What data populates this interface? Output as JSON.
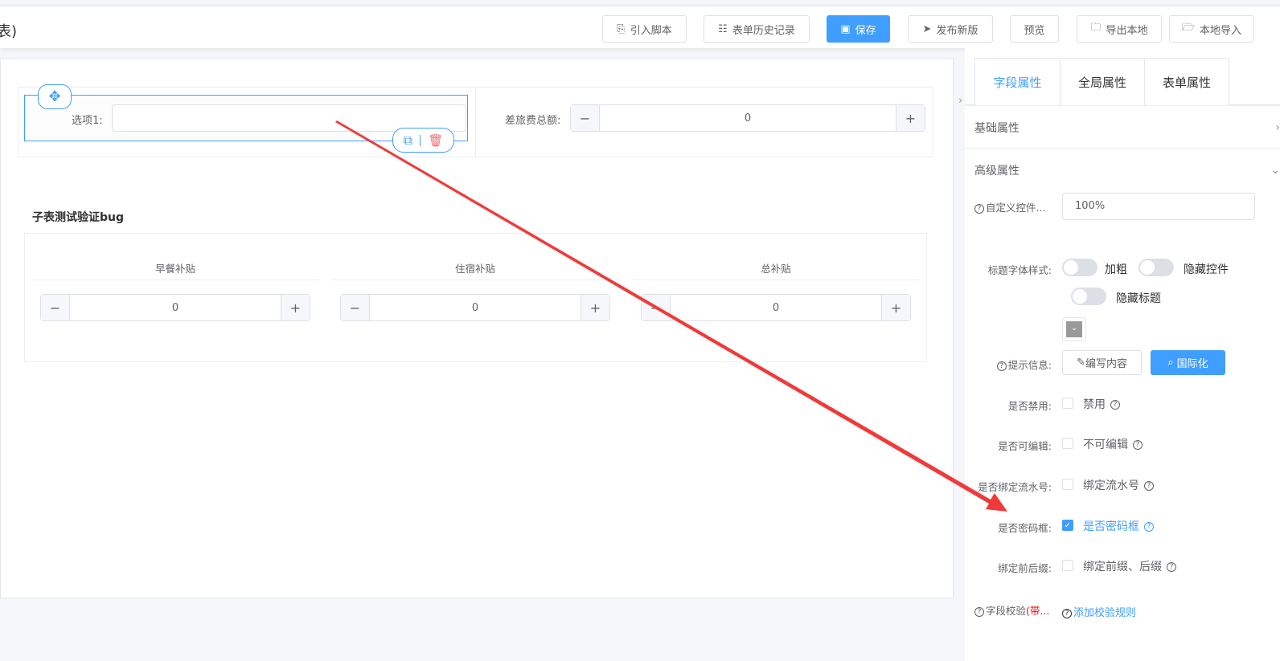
{
  "header": {
    "title": "表)",
    "buttons": [
      {
        "label": "引入脚本",
        "icon": "script-icon"
      },
      {
        "label": "表单历史记录",
        "icon": "list-icon"
      },
      {
        "label": "保存",
        "icon": "save-icon"
      },
      {
        "label": "发布新版",
        "icon": "send-icon"
      },
      {
        "label": "预览"
      },
      {
        "label": "导出本地",
        "icon": "folder-icon"
      },
      {
        "label": "本地导入",
        "icon": "folder-open-icon"
      }
    ]
  },
  "form": {
    "field1": {
      "label": "选项1:",
      "value": ""
    },
    "field2": {
      "label": "差旅费总额:",
      "value": "0",
      "minus": "−",
      "plus": "+"
    },
    "subtable": {
      "title": "子表测试验证bug",
      "columns": [
        {
          "header": "早餐补贴",
          "value": "0"
        },
        {
          "header": "住宿补贴",
          "value": "0"
        },
        {
          "header": "总补贴",
          "value": "0"
        }
      ]
    }
  },
  "panel": {
    "tabs": [
      "字段属性",
      "全局属性",
      "表单属性"
    ],
    "sections": [
      "基础属性",
      "高级属性"
    ],
    "custom_width": {
      "label": "自定义控件...",
      "value": "100%"
    },
    "title_style": {
      "label": "标题字体样式:",
      "switches": [
        "加粗",
        "隐藏控件",
        "隐藏标题"
      ]
    },
    "tips": {
      "label": "提示信息:",
      "edit": "编写内容",
      "i18n": "国际化"
    },
    "checks": [
      {
        "label": "是否禁用:",
        "text": "禁用",
        "checked": false
      },
      {
        "label": "是否可编辑:",
        "text": "不可编辑",
        "checked": false
      },
      {
        "label": "是否绑定流水号:",
        "text": "绑定流水号",
        "checked": false
      },
      {
        "label": "是否密码框:",
        "text": "是否密码框",
        "checked": true
      },
      {
        "label": "绑定前后缀:",
        "text": "绑定前缀、后缀",
        "checked": false
      }
    ],
    "validation": {
      "label": "字段校验",
      "label_red": "(带...",
      "link": "添加校验规则"
    }
  },
  "colors": {
    "primary": "#409eff",
    "arrow": "#f03a3a",
    "danger": "#f56c6c"
  }
}
